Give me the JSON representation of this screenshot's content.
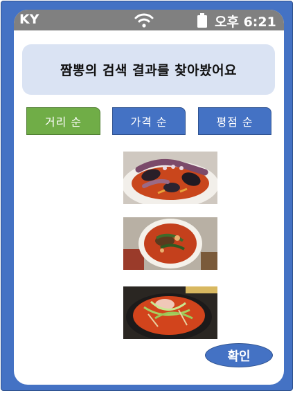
{
  "status_bar": {
    "carrier": "KY",
    "time": "오후 6:21",
    "icons": [
      "wifi-icon",
      "battery-icon"
    ]
  },
  "search_result": {
    "message": "짬뽕의 검색 결과를 찾아봤어요"
  },
  "sort_options": [
    {
      "label": "거리 순",
      "selected": true,
      "color": "#70ad47"
    },
    {
      "label": "가격 순",
      "selected": false,
      "color": "#4472c4"
    },
    {
      "label": "평점 순",
      "selected": false,
      "color": "#4472c4"
    }
  ],
  "results": [
    {
      "image": "seafood-jjamppong-photo"
    },
    {
      "image": "jjamppong-bowl-photo"
    },
    {
      "image": "spicy-noodle-soup-photo"
    }
  ],
  "confirm_button": {
    "label": "확인"
  },
  "colors": {
    "frame": "#4472c4",
    "status_bar": "#808080",
    "banner": "#dae3f3",
    "selected": "#70ad47",
    "unselected": "#4472c4"
  }
}
